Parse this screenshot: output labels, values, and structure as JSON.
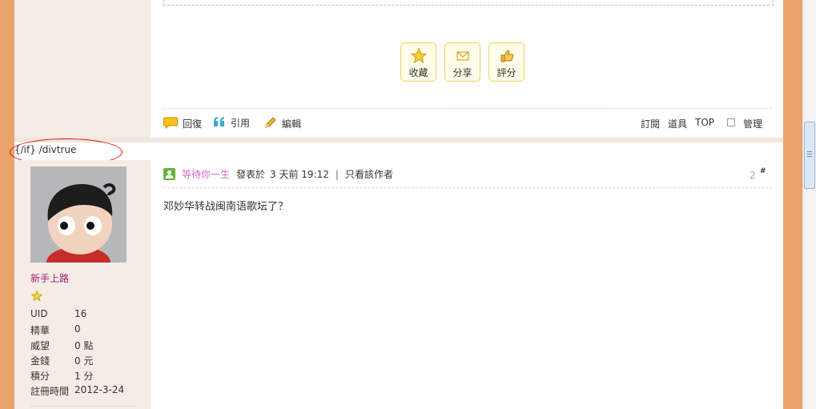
{
  "post1": {
    "actions": [
      {
        "label": "收藏",
        "icon": "star-icon"
      },
      {
        "label": "分享",
        "icon": "share-mail-icon"
      },
      {
        "label": "評分",
        "icon": "thumbs-up-icon"
      }
    ],
    "tools_left": [
      {
        "label": "回復",
        "icon": "reply-bubble-icon"
      },
      {
        "label": "引用",
        "icon": "quote-icon"
      },
      {
        "label": "編輯",
        "icon": "pencil-edit-icon"
      }
    ],
    "tools_right": {
      "subscribe": "訂閱",
      "tools": "道具",
      "top": "TOP",
      "manage": "管理"
    }
  },
  "template_artifact": "{/if} /divtrue",
  "post2": {
    "author": {
      "name": "等待你一生",
      "rank": "新手上路",
      "stats": [
        {
          "label": "UID",
          "value": "16"
        },
        {
          "label": "精華",
          "value": "0"
        },
        {
          "label": "威望",
          "value": "0 點"
        },
        {
          "label": "金錢",
          "value": "0 元"
        },
        {
          "label": "積分",
          "value": "1 分"
        },
        {
          "label": "註冊時間",
          "value": "2012-3-24"
        }
      ]
    },
    "meta": {
      "posted_prefix": "發表於",
      "posted_time": "3 天前 19:12",
      "divider": "|",
      "only_author": "只看該作者"
    },
    "floor": {
      "number": "2",
      "symbol": "#"
    },
    "content": "邓妙华转战闽南语歌坛了？"
  },
  "colors": {
    "frame": "#e9a36b",
    "sidebar": "#f6ece6",
    "author": "#d16fc8",
    "rank": "#a0206a",
    "button_border": "#f0cf5e"
  }
}
